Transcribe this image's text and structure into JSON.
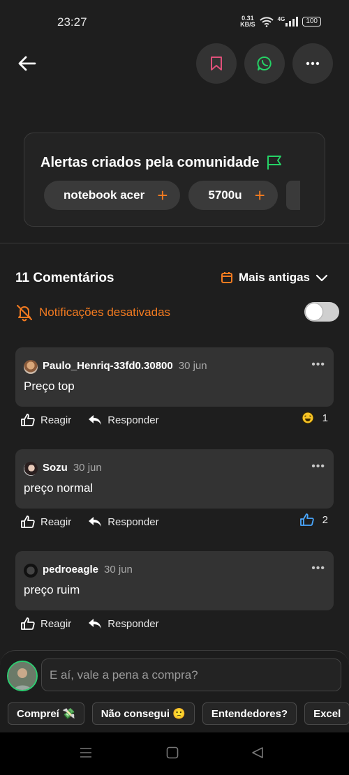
{
  "status_bar": {
    "time": "23:27",
    "net_speed_value": "0.31",
    "net_speed_unit": "KB/S",
    "signal_label": "4G",
    "battery": "100"
  },
  "top_nav": {
    "icons": [
      "back-arrow-icon",
      "bookmark-icon",
      "whatsapp-icon",
      "more-icon"
    ]
  },
  "alerts": {
    "title": "Alertas criados pela comunidade",
    "chips": [
      {
        "label": "notebook acer",
        "action": "+"
      },
      {
        "label": "5700u",
        "action": "+"
      }
    ]
  },
  "comments_section": {
    "count_label": "11 Comentários",
    "sort_label": "Mais antigas",
    "notifications_label": "Notificações desativadas",
    "notifications_enabled": false,
    "react_label": "Reagir",
    "reply_label": "Responder",
    "more_label": "•••"
  },
  "comments": [
    {
      "user": "Paulo_Henriq-33fd0.30800",
      "date": "30 jun",
      "text": "Preço top",
      "reaction_icon": "laughing-emoji",
      "reaction_count": "1"
    },
    {
      "user": "Sozu",
      "date": "30 jun",
      "text": "preço normal",
      "reaction_icon": "thumbs-up",
      "reaction_count": "2"
    },
    {
      "user": "pedroeagle",
      "date": "30 jun",
      "text": "preço ruim",
      "reaction_icon": "",
      "reaction_count": ""
    }
  ],
  "composer": {
    "placeholder": "E aí, vale a pena a compra?",
    "quick_replies": [
      "Compreí 💸",
      "Não consegui 🙁",
      "Entendedores?",
      "Excel"
    ]
  },
  "colors": {
    "accent": "#f47b20",
    "background": "#1e1e1e",
    "card": "#333333",
    "whatsapp": "#25d366",
    "bookmark": "#e0507a",
    "like_blue": "#4aa8ff"
  }
}
